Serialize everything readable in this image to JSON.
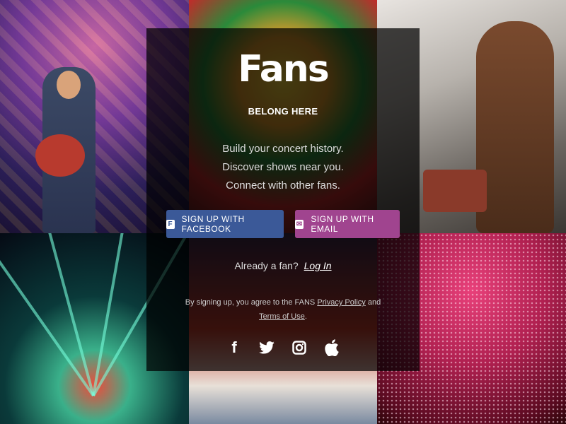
{
  "brand": {
    "logo": "Fans",
    "tagline": "BELONG HERE"
  },
  "pitch": {
    "line1": "Build your concert history.",
    "line2": "Discover shows near you.",
    "line3": "Connect with other fans."
  },
  "buttons": {
    "facebook": {
      "label": "SIGN UP WITH FACEBOOK",
      "icon": "facebook-icon",
      "color": "#3b5998"
    },
    "email": {
      "label": "SIGN UP WITH EMAIL",
      "icon": "envelope-icon",
      "color": "#a0448f"
    }
  },
  "login": {
    "prompt": "Already a fan?",
    "link": "Log In"
  },
  "terms": {
    "before": "By signing up, you agree to the FANS",
    "privacy": "Privacy Policy",
    "and": "and",
    "terms": "Terms of Use",
    "after": "."
  },
  "social": [
    {
      "name": "facebook",
      "icon": "facebook-icon"
    },
    {
      "name": "twitter",
      "icon": "twitter-icon"
    },
    {
      "name": "instagram",
      "icon": "instagram-icon"
    },
    {
      "name": "apple",
      "icon": "apple-icon"
    }
  ]
}
